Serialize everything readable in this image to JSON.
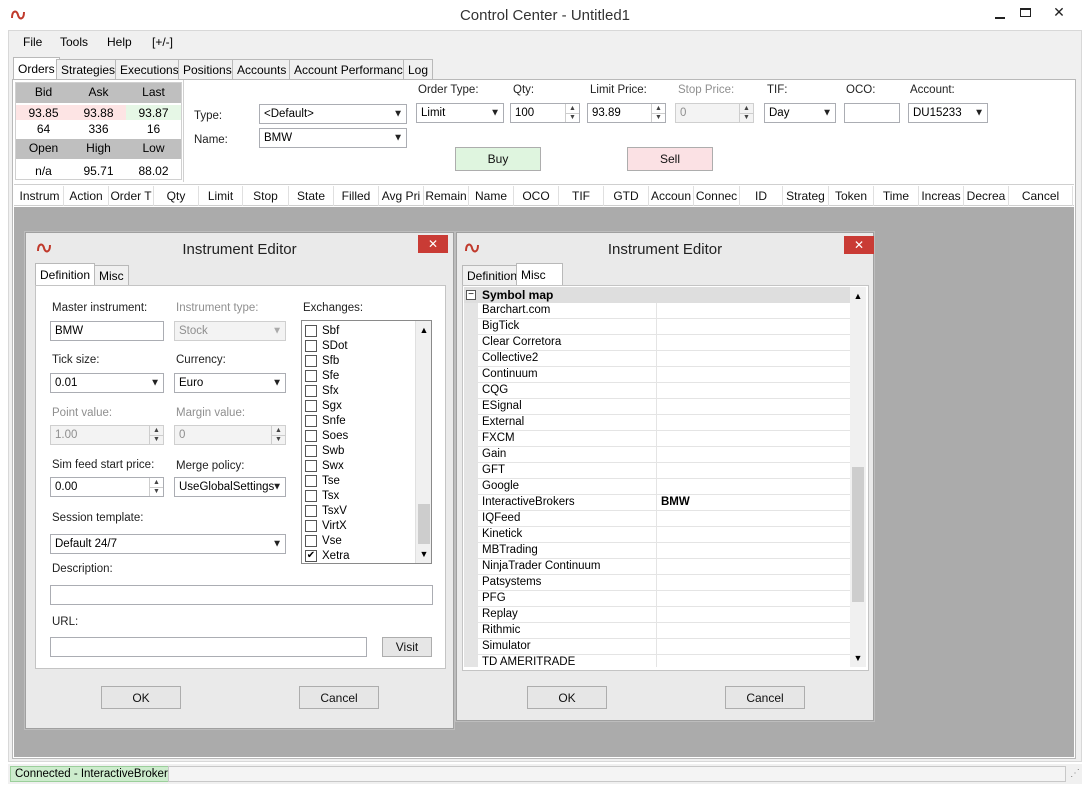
{
  "window": {
    "title": "Control Center - Untitled1",
    "controls": [
      "minimize-icon",
      "maximize-icon",
      "close-icon"
    ]
  },
  "menu": {
    "items": [
      "File",
      "Tools",
      "Help",
      "[+/-]"
    ]
  },
  "tabs": [
    "Orders",
    "Strategies",
    "Executions",
    "Positions",
    "Accounts",
    "Account Performance",
    "Log"
  ],
  "quote": {
    "bid_label": "Bid",
    "ask_label": "Ask",
    "last_label": "Last",
    "bid": "93.85",
    "ask": "93.88",
    "last": "93.87",
    "bid_size": "64",
    "ask_size": "336",
    "last_size": "16",
    "open_label": "Open",
    "high_label": "High",
    "low_label": "Low",
    "open": "n/a",
    "high": "95.71",
    "low": "88.02"
  },
  "order_entry": {
    "type_label": "Type:",
    "type_value": "<Default>",
    "name_label": "Name:",
    "name_value": "BMW",
    "order_type_label": "Order Type:",
    "order_type_value": "Limit",
    "qty_label": "Qty:",
    "qty_value": "100",
    "limit_price_label": "Limit Price:",
    "limit_price_value": "93.89",
    "stop_price_label": "Stop Price:",
    "stop_price_value": "0",
    "tif_label": "TIF:",
    "tif_value": "Day",
    "oco_label": "OCO:",
    "oco_value": "",
    "account_label": "Account:",
    "account_value": "DU15233",
    "buy_label": "Buy",
    "sell_label": "Sell"
  },
  "grid_columns": [
    "Instrum",
    "Action",
    "Order T",
    "Qty",
    "Limit",
    "Stop",
    "State",
    "Filled",
    "Avg Pri",
    "Remain",
    "Name",
    "OCO",
    "TIF",
    "GTD",
    "Accoun",
    "Connec",
    "ID",
    "Strateg",
    "Token",
    "Time",
    "Increas",
    "Decrea",
    "Cancel"
  ],
  "editor1": {
    "title": "Instrument Editor",
    "close_glyph": "✕",
    "tabs": [
      "Definition",
      "Misc"
    ],
    "master_instrument_label": "Master instrument:",
    "master_instrument_value": "BMW",
    "instrument_type_label": "Instrument type:",
    "instrument_type_value": "Stock",
    "exchanges_label": "Exchanges:",
    "tick_size_label": "Tick size:",
    "tick_size_value": "0.01",
    "currency_label": "Currency:",
    "currency_value": "Euro",
    "point_value_label": "Point value:",
    "point_value_value": "1.00",
    "margin_value_label": "Margin value:",
    "margin_value_value": "0",
    "sim_feed_label": "Sim feed start price:",
    "sim_feed_value": "0.00",
    "merge_policy_label": "Merge policy:",
    "merge_policy_value": "UseGlobalSettings",
    "session_template_label": "Session template:",
    "session_template_value": "Default 24/7",
    "description_label": "Description:",
    "description_value": "",
    "url_label": "URL:",
    "url_value": "",
    "visit_label": "Visit",
    "ok_label": "OK",
    "cancel_label": "Cancel",
    "exchanges": [
      {
        "name": "Sbf",
        "checked": false
      },
      {
        "name": "SDot",
        "checked": false
      },
      {
        "name": "Sfb",
        "checked": false
      },
      {
        "name": "Sfe",
        "checked": false
      },
      {
        "name": "Sfx",
        "checked": false
      },
      {
        "name": "Sgx",
        "checked": false
      },
      {
        "name": "Snfe",
        "checked": false
      },
      {
        "name": "Soes",
        "checked": false
      },
      {
        "name": "Swb",
        "checked": false
      },
      {
        "name": "Swx",
        "checked": false
      },
      {
        "name": "Tse",
        "checked": false
      },
      {
        "name": "Tsx",
        "checked": false
      },
      {
        "name": "TsxV",
        "checked": false
      },
      {
        "name": "VirtX",
        "checked": false
      },
      {
        "name": "Vse",
        "checked": false
      },
      {
        "name": "Xetra",
        "checked": true
      }
    ]
  },
  "editor2": {
    "title": "Instrument Editor",
    "close_glyph": "✕",
    "tabs": [
      "Definition",
      "Misc"
    ],
    "section_title": "Symbol map",
    "ok_label": "OK",
    "cancel_label": "Cancel",
    "symbols": [
      {
        "provider": "Barchart.com",
        "symbol": ""
      },
      {
        "provider": "BigTick",
        "symbol": ""
      },
      {
        "provider": "Clear Corretora",
        "symbol": ""
      },
      {
        "provider": "Collective2",
        "symbol": ""
      },
      {
        "provider": "Continuum",
        "symbol": ""
      },
      {
        "provider": "CQG",
        "symbol": ""
      },
      {
        "provider": "ESignal",
        "symbol": ""
      },
      {
        "provider": "External",
        "symbol": ""
      },
      {
        "provider": "FXCM",
        "symbol": ""
      },
      {
        "provider": "Gain",
        "symbol": ""
      },
      {
        "provider": "GFT",
        "symbol": ""
      },
      {
        "provider": "Google",
        "symbol": ""
      },
      {
        "provider": "InteractiveBrokers",
        "symbol": "BMW"
      },
      {
        "provider": "IQFeed",
        "symbol": ""
      },
      {
        "provider": "Kinetick",
        "symbol": ""
      },
      {
        "provider": "MBTrading",
        "symbol": ""
      },
      {
        "provider": "NinjaTrader Continuum",
        "symbol": ""
      },
      {
        "provider": "Patsystems",
        "symbol": ""
      },
      {
        "provider": "PFG",
        "symbol": ""
      },
      {
        "provider": "Replay",
        "symbol": ""
      },
      {
        "provider": "Rithmic",
        "symbol": ""
      },
      {
        "provider": "Simulator",
        "symbol": ""
      },
      {
        "provider": "TD AMERITRADE",
        "symbol": ""
      }
    ]
  },
  "status": {
    "connection": "Connected - InteractiveBrokers"
  },
  "colors": {
    "logo": "#c0392b",
    "close_button": "#c93b35",
    "bid_cell": "#fde4e4",
    "ask_cell": "#fde4e4",
    "last_cell": "#e6f7e6",
    "buy_button": "#dff5df",
    "sell_button": "#fbe1e4",
    "status_ok": "#cdeccd",
    "workspace": "#ababab"
  }
}
